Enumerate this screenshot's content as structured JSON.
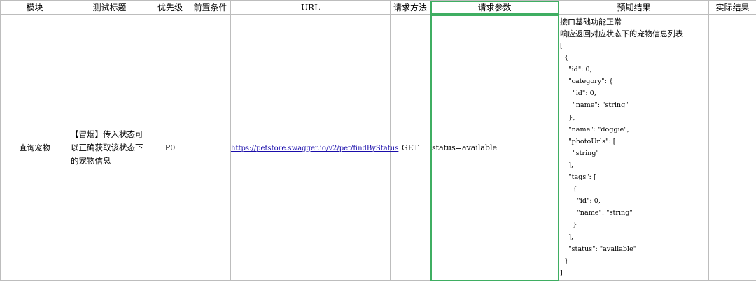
{
  "headers": {
    "module": "模块",
    "title": "测试标题",
    "priority": "优先级",
    "precondition": "前置条件",
    "url": "URL",
    "method": "请求方法",
    "params": "请求参数",
    "expected": "预期结果",
    "actual": "实际结果"
  },
  "row": {
    "module": "查询宠物",
    "title": "【冒烟】传入状态可以正确获取该状态下的宠物信息",
    "priority": "P0",
    "precondition": "",
    "url": "https://petstore.swagger.io/v2/pet/findByStatus",
    "method": "GET",
    "params": "status=available",
    "expected_line1": "接口基础功能正常",
    "expected_line2": "响应返回对应状态下的宠物信息列表",
    "expected_json": "[\n  {\n    \"id\": 0,\n    \"category\": {\n      \"id\": 0,\n      \"name\": \"string\"\n    },\n    \"name\": \"doggie\",\n    \"photoUrls\": [\n      \"string\"\n    ],\n    \"tags\": [\n      {\n        \"id\": 0,\n        \"name\": \"string\"\n      }\n    ],\n    \"status\": \"available\"\n  }\n]",
    "actual": ""
  },
  "colors": {
    "grid": "#bdbdbd",
    "selection": "#3fae62",
    "link": "#1a0dab"
  }
}
